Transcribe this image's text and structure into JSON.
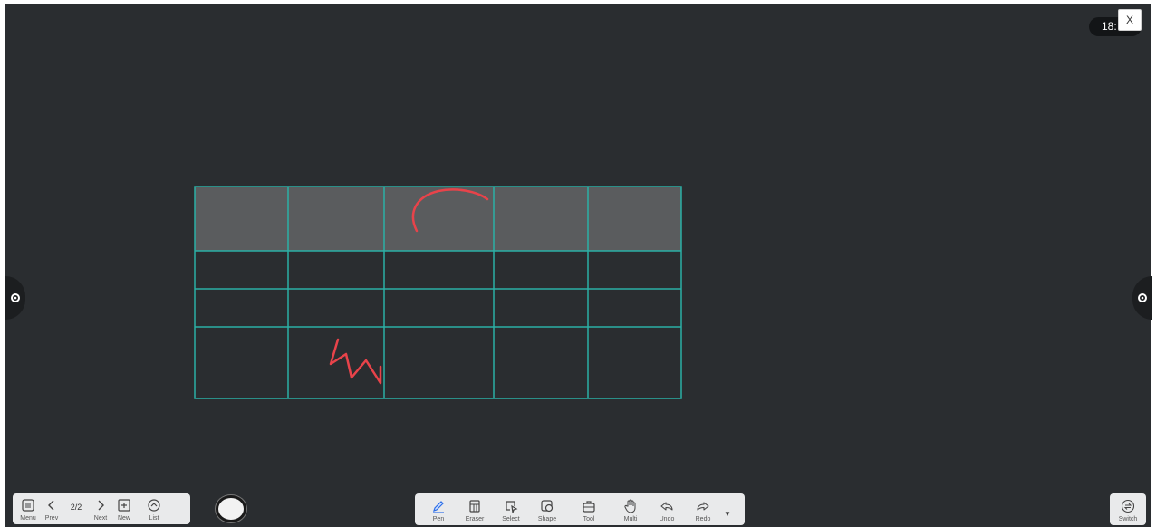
{
  "clock": {
    "time": "18:"
  },
  "close": {
    "label": "X"
  },
  "table": {
    "rows": 4,
    "cols": 5,
    "header_fill": "#5a5c5e",
    "line_color": "#2ab0a6"
  },
  "ink_color": "#e8434a",
  "left_bar": {
    "menu": "Menu",
    "prev": "Prev",
    "page": "2/2",
    "next": "Next",
    "new": "New",
    "list": "List"
  },
  "center_bar": {
    "pen": "Pen",
    "eraser": "Eraser",
    "select": "Select",
    "shape": "Shape",
    "tool": "Tool",
    "multi": "Multi",
    "undo": "Undo",
    "redo": "Redo"
  },
  "switch_bar": {
    "switch": "Switch"
  },
  "icons": [
    "menu-icon",
    "chevron-left-icon",
    "chevron-right-icon",
    "add-page-icon",
    "list-icon",
    "pen-icon",
    "eraser-icon",
    "select-icon",
    "shape-icon",
    "toolbox-icon",
    "hand-icon",
    "undo-icon",
    "redo-icon",
    "switch-icon",
    "gear-icon"
  ]
}
